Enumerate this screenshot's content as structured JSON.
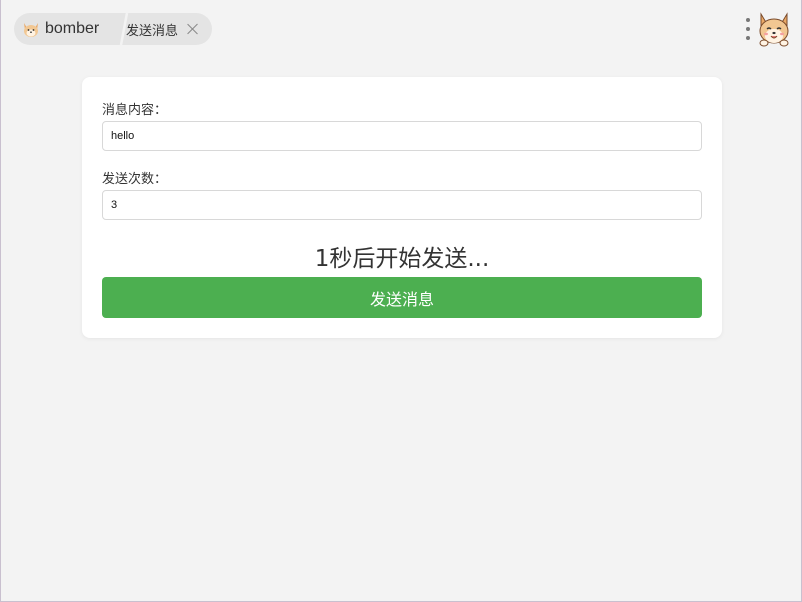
{
  "header": {
    "app_name": "bomber",
    "active_tab": "发送消息"
  },
  "form": {
    "message_label": "消息内容：",
    "message_value": "hello",
    "count_label": "发送次数：",
    "count_value": "3",
    "countdown_text": "1秒后开始发送...",
    "send_button_label": "发送消息"
  },
  "colors": {
    "send_button": "#4caf50",
    "background": "#f3f3f3",
    "card": "#ffffff"
  },
  "icons": {
    "app_logo": "shiba-dog-icon",
    "avatar": "shiba-dog-avatar",
    "menu": "more-vertical-icon",
    "close": "close-icon"
  }
}
